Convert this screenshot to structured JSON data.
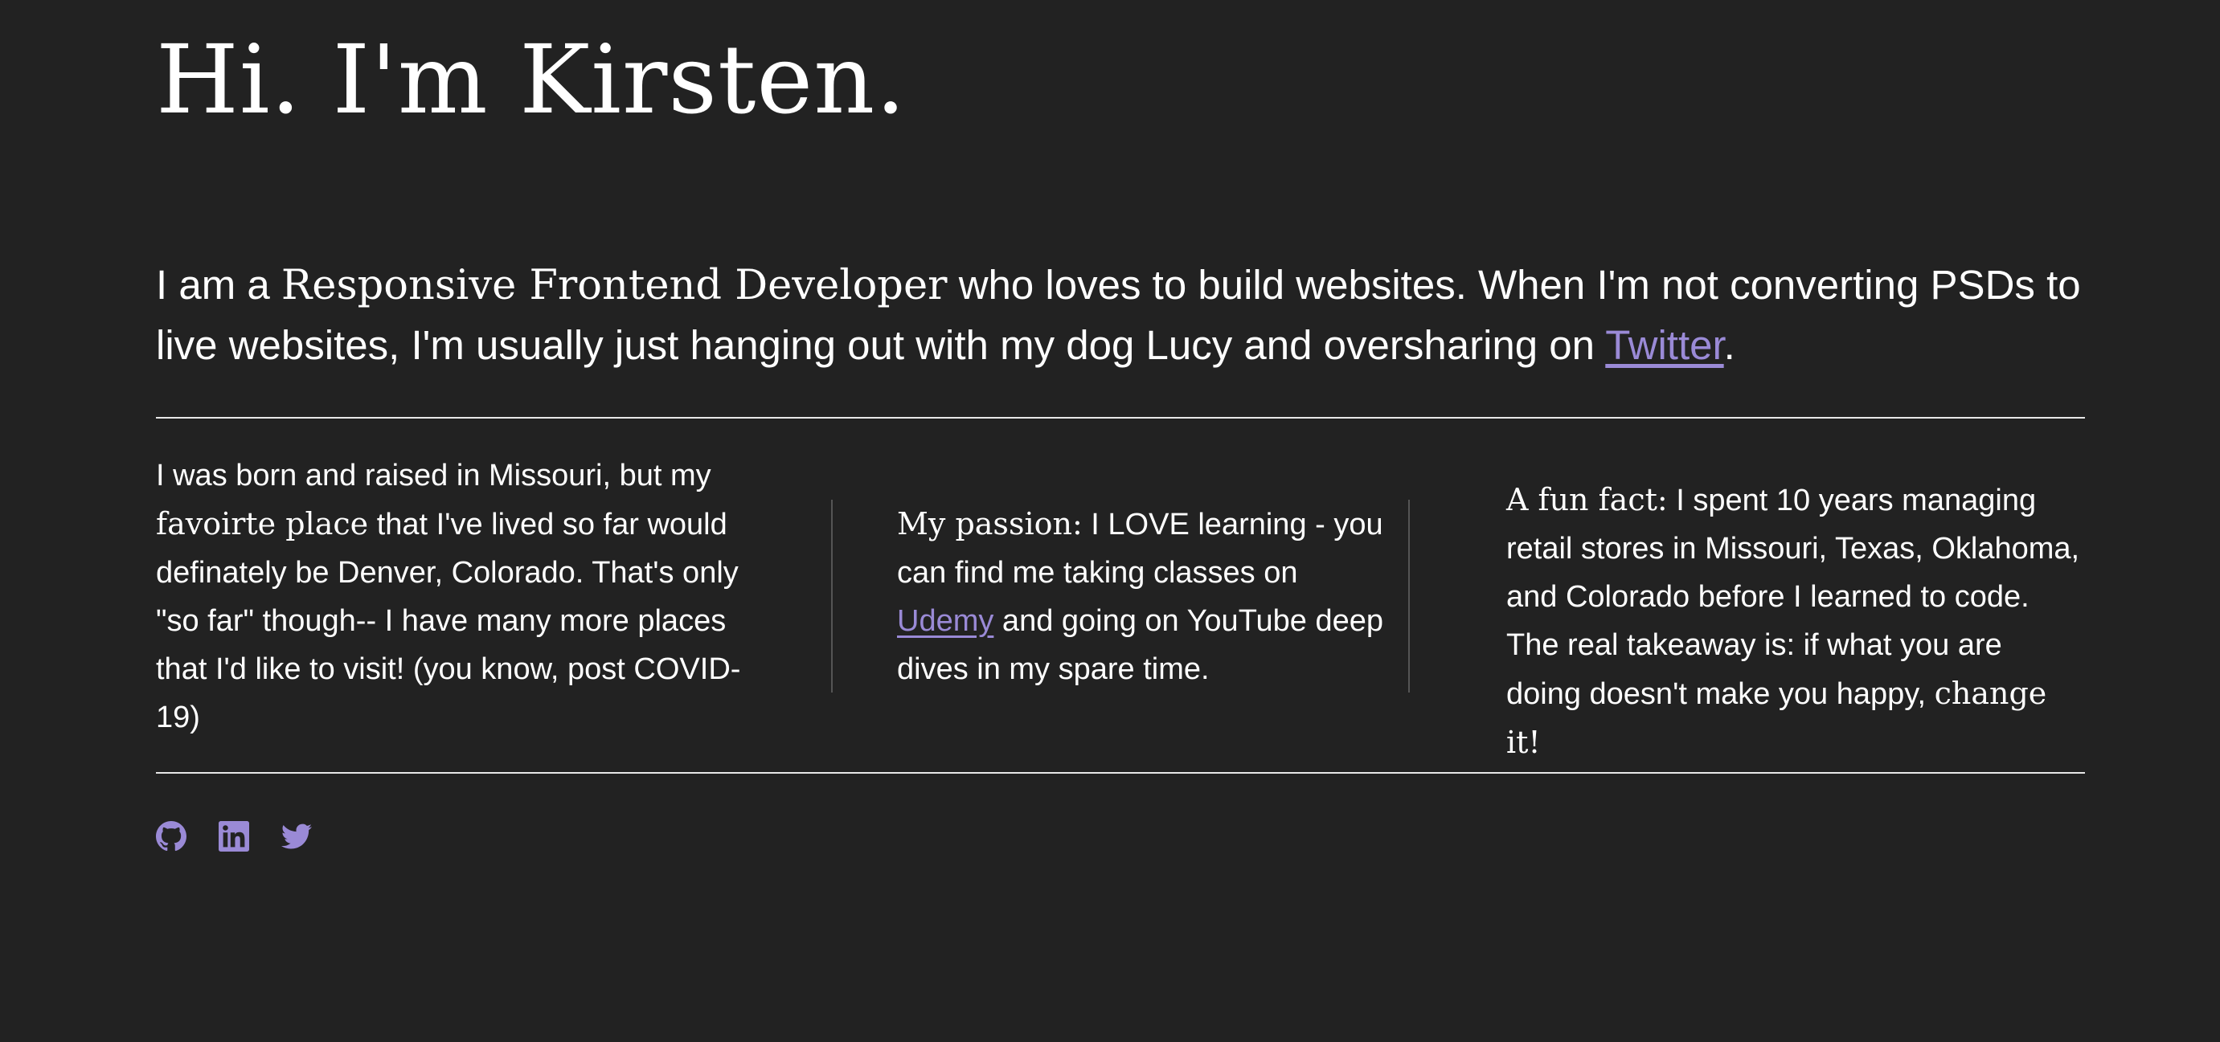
{
  "hero": {
    "title": "Hi. I'm Kirsten."
  },
  "intro": {
    "part1": "I am a ",
    "serif_phrase": "Responsive Frontend Developer",
    "part2": " who loves to build websites. When I'm not converting PSDs to live websites, I'm usually just hanging out with my dog Lucy and oversharing on ",
    "twitter_link": "Twitter",
    "end": "."
  },
  "columns": {
    "col1": {
      "part1": "I was born and raised in Missouri, but my ",
      "serif_phrase": "favoirte place",
      "part2": " that I've lived so far would definately be Denver, Colorado. That's only \"so far\" though-- I have many more places that I'd like to visit! (you know, post COVID-19)"
    },
    "col2": {
      "serif_phrase": "My passion:",
      "part1": " I LOVE learning - you can find me taking classes on ",
      "udemy_link": "Udemy",
      "part2": " and going on YouTube deep dives in my spare time."
    },
    "col3": {
      "serif_phrase": "A fun fact:",
      "part1": " I spent 10 years managing retail stores in Missouri, Texas, Oklahoma, and Colorado before I learned to code. The real takeaway is: if what you are doing doesn't make you happy, ",
      "serif_end": "change it!"
    }
  },
  "social": {
    "icons": [
      "github-icon",
      "linkedin-icon",
      "twitter-icon"
    ]
  },
  "colors": {
    "background": "#222222",
    "text": "#ffffff",
    "accent": "#9a8ad6",
    "rule": "#e8e8e8",
    "divider": "#555555"
  }
}
